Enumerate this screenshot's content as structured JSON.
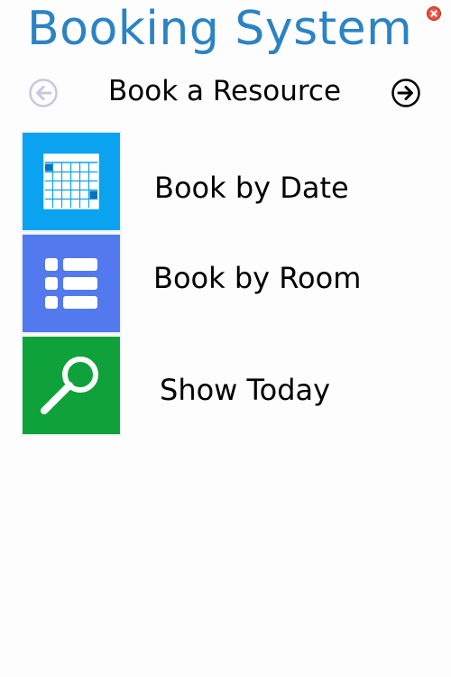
{
  "app": {
    "title": "Booking System",
    "title_color": "#2b83c3"
  },
  "window": {
    "close_icon": "close-icon",
    "close_color": "#e8412c"
  },
  "nav": {
    "back_icon": "arrow-left-icon",
    "back_enabled": false,
    "forward_icon": "arrow-right-icon",
    "title": "Book a Resource"
  },
  "menu": {
    "items": [
      {
        "label": "Book by Date",
        "icon": "calendar-icon",
        "tile_color": "#0ba3ef"
      },
      {
        "label": "Book by Room",
        "icon": "list-icon",
        "tile_color": "#5279ee"
      },
      {
        "label": "Show Today",
        "icon": "search-icon",
        "tile_color": "#0fa23a"
      }
    ]
  }
}
